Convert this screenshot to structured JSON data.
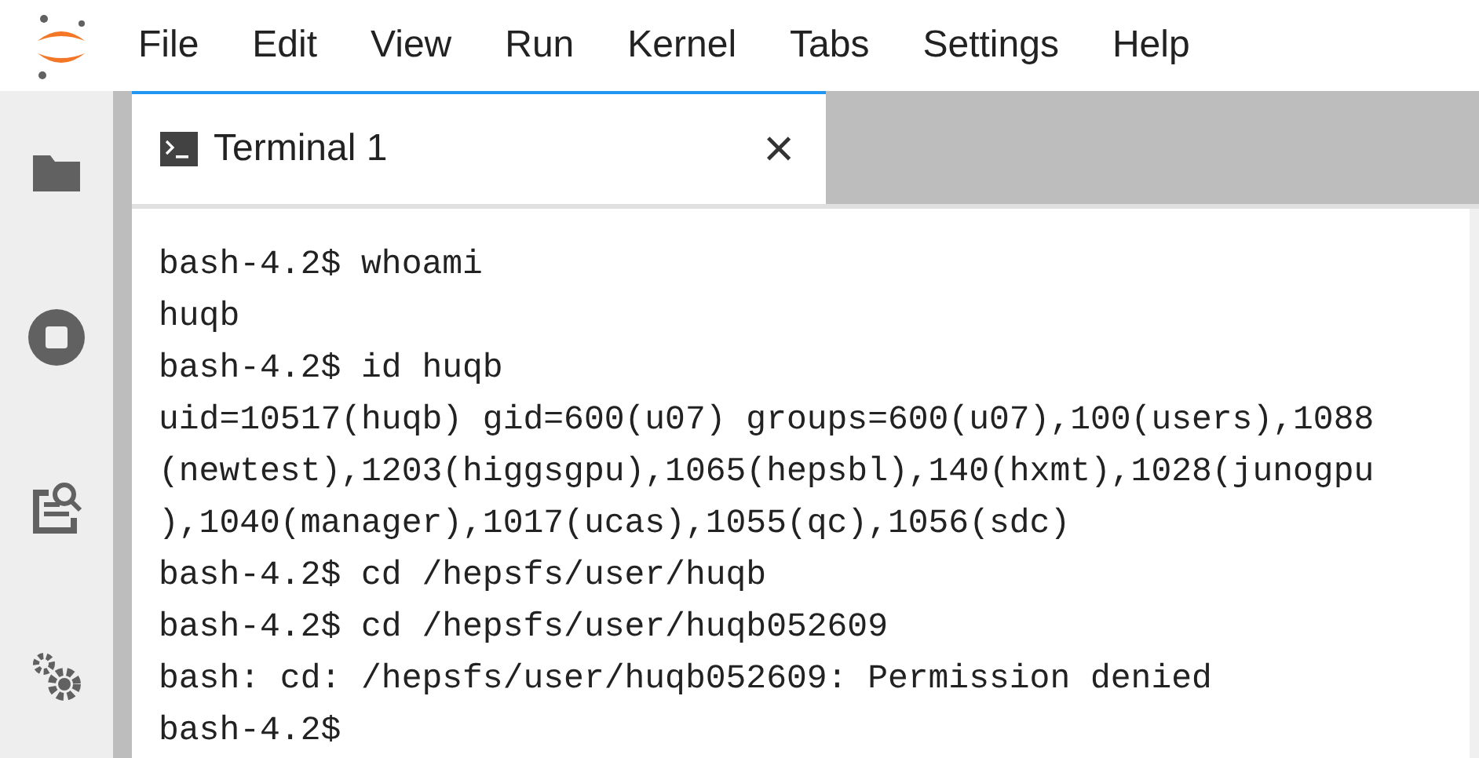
{
  "menu": [
    "File",
    "Edit",
    "View",
    "Run",
    "Kernel",
    "Tabs",
    "Settings",
    "Help"
  ],
  "tabs": [
    {
      "label": "Terminal 1",
      "selected": true,
      "close": "×"
    }
  ],
  "terminal": {
    "lines": [
      "bash-4.2$ whoami",
      "huqb",
      "bash-4.2$ id huqb",
      "uid=10517(huqb) gid=600(u07) groups=600(u07),100(users),1088",
      "(newtest),1203(higgsgpu),1065(hepsbl),140(hxmt),1028(junogpu",
      "),1040(manager),1017(ucas),1055(qc),1056(sdc)",
      "bash-4.2$ cd /hepsfs/user/huqb",
      "bash-4.2$ cd /hepsfs/user/huqb052609",
      "bash: cd: /hepsfs/user/huqb052609: Permission denied",
      "bash-4.2$"
    ]
  }
}
